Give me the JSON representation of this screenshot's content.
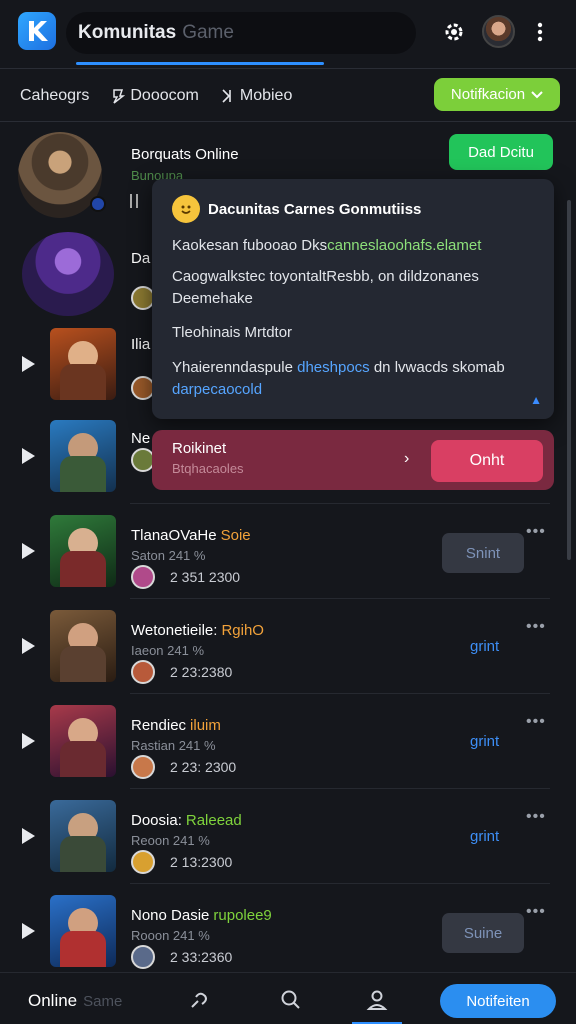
{
  "header": {
    "title": "Komunitas",
    "search_placeholder": "Game",
    "icons": [
      "app-logo-icon",
      "settings-gear-icon",
      "user-avatar",
      "more-vertical-icon"
    ]
  },
  "filters": {
    "categories": "Caheogrs",
    "item2": "Dooocom",
    "item3": "Mobieo",
    "notif_button": "Notifkacion"
  },
  "featured": [
    {
      "title": "Borquats Online",
      "sub": "Bunoupa",
      "action": "Dad Dcitu"
    },
    {
      "title": "Da"
    }
  ],
  "popover": {
    "title": "Dacunitas Carnes Gonmutiiss",
    "line1_a": "Kaokesan fubooao Dks",
    "line1_b": "canneslaoohafs.elamet",
    "line2_a": "Caogwalkstec toyontaltResbb, on dildzonanes",
    "line2_b": "Deemehake",
    "line3": "Tleohinais Mrtdtor",
    "line4_a": "Yhaierenndaspule ",
    "line4_b": "dheshpocs",
    "line4_c": " dn lvwacds skomab",
    "line4_d": "darpecaocold"
  },
  "banner": {
    "title": "Roikinet",
    "subtitle": "Btqhacaoles",
    "chevron": "›",
    "button": "Onht"
  },
  "partial_rows": [
    {
      "title": "Ilia"
    },
    {
      "title": "Ne"
    }
  ],
  "rows": [
    {
      "title": "TlanaOVaHe",
      "accent": "Soie",
      "accent_color": "#f2a23a",
      "sub": "Saton 241 %",
      "stat": "2 351 2300",
      "action": "Snint",
      "action_style": "button"
    },
    {
      "title": "Wetonetieile:",
      "accent": "RgihO",
      "accent_color": "#f2a23a",
      "sub": "Iaeon 241 %",
      "stat": "2 23:2380",
      "action": "grint",
      "action_style": "link"
    },
    {
      "title": "Rendiec",
      "accent": "iluim",
      "accent_color": "#f2a23a",
      "sub": "Rastian 241 %",
      "stat": "2 23: 2300",
      "action": "grint",
      "action_style": "link"
    },
    {
      "title": "Doosia:",
      "accent": "Raleead",
      "accent_color": "#7fd33c",
      "sub": "Reoon 241 %",
      "stat": "2 13:2300",
      "action": "grint",
      "action_style": "link"
    },
    {
      "title": "Nono Dasie",
      "accent": "rupolee9",
      "accent_color": "#7fd33c",
      "sub": "Rooon 241 %",
      "stat": "2 33:2360",
      "action": "Suine",
      "action_style": "button"
    }
  ],
  "bottom_nav": {
    "online": "Online",
    "online_ph": "Same",
    "button": "Notifeiten"
  },
  "colors": {
    "background": "#15171c",
    "accent_blue": "#2d8fff",
    "green": "#22c45a",
    "lime": "#7ccf3a",
    "banner": "#7a2940",
    "banner_button": "#d93f63"
  }
}
